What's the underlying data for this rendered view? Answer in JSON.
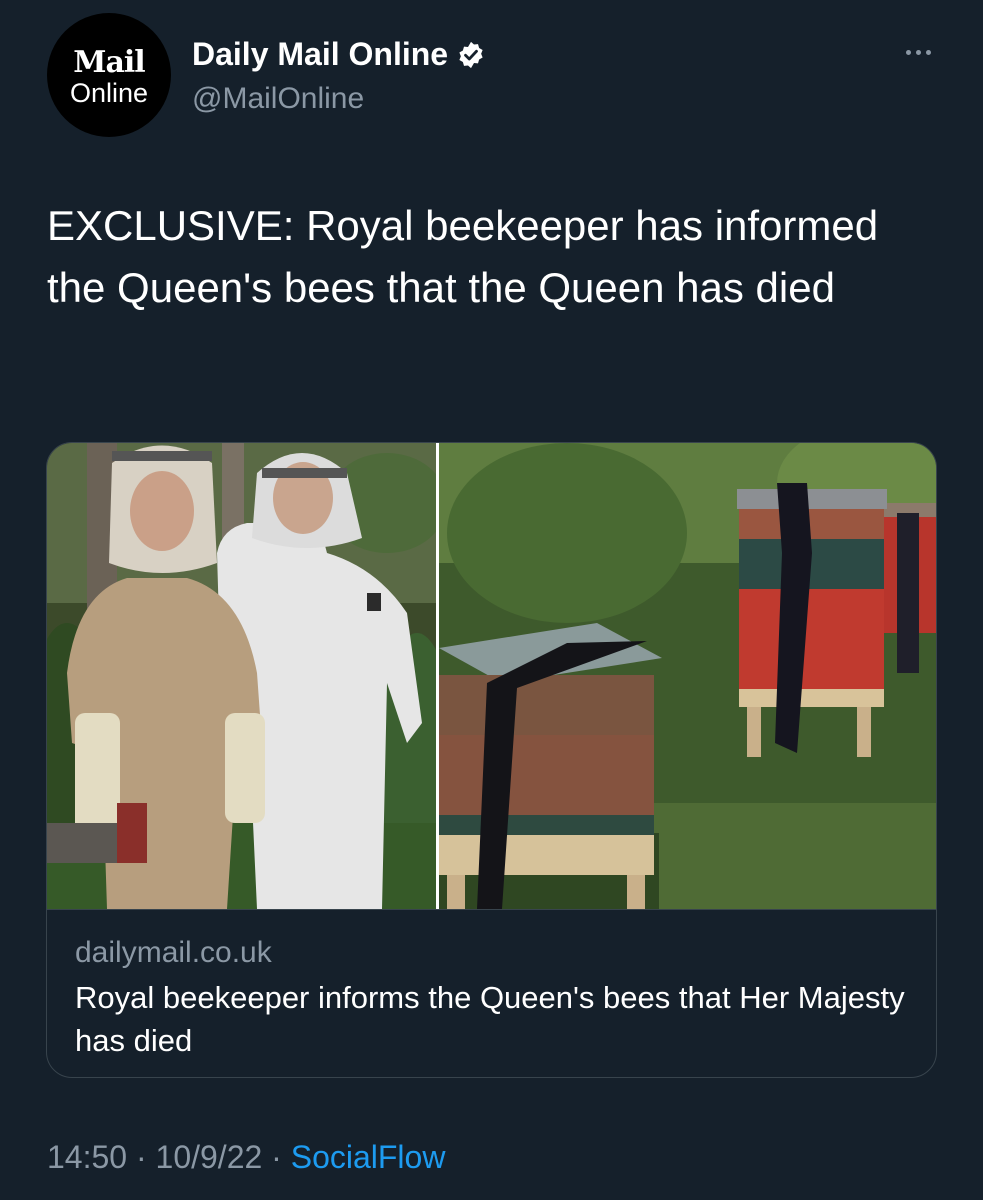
{
  "author": {
    "avatar_logo_top": "Mail",
    "avatar_logo_bottom": "Online",
    "display_name": "Daily Mail Online",
    "handle": "@MailOnline",
    "verified": true
  },
  "tweet": {
    "text": "EXCLUSIVE: Royal beekeeper has informed the Queen's bees that the Queen has died"
  },
  "card": {
    "domain": "dailymail.co.uk",
    "title": "Royal beekeeper informs the Queen's bees that Her Majesty has died"
  },
  "footer": {
    "time": "14:50",
    "separator_1": " · ",
    "date": "10/9/22",
    "separator_2": " · ",
    "source": "SocialFlow"
  },
  "icons": {
    "verified": "verified-badge-icon",
    "more": "more-options-icon"
  },
  "colors": {
    "background": "#15202b",
    "secondary_text": "#8b98a5",
    "link": "#1d9bf0",
    "border": "#38444d"
  }
}
